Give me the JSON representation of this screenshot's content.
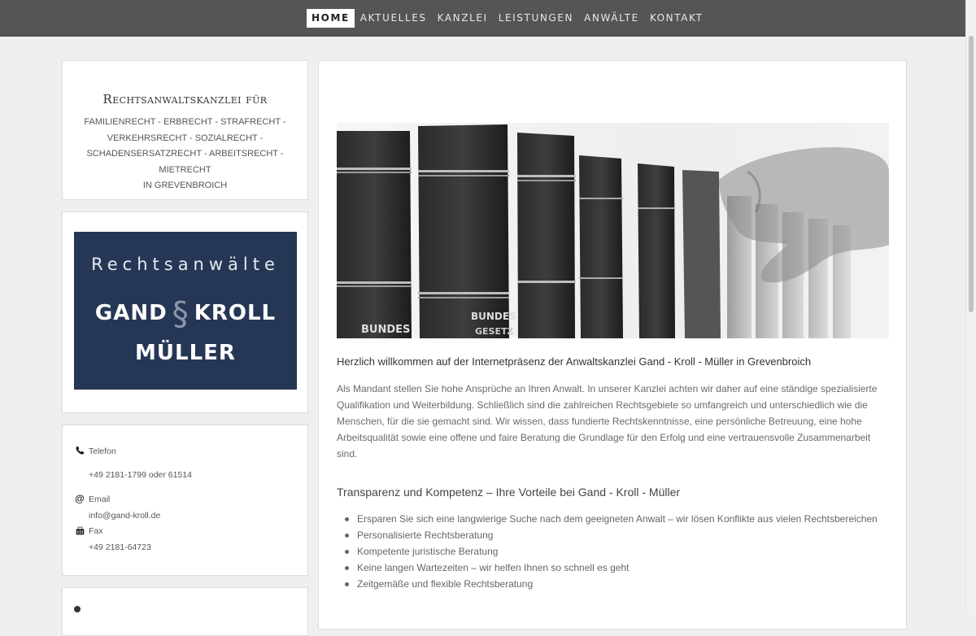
{
  "nav": {
    "items": [
      {
        "label": "HOME",
        "active": true
      },
      {
        "label": "AKTUELLES",
        "active": false
      },
      {
        "label": "KANZLEI",
        "active": false
      },
      {
        "label": "LEISTUNGEN",
        "active": false
      },
      {
        "label": "ANWÄLTE",
        "active": false
      },
      {
        "label": "KONTAKT",
        "active": false
      }
    ]
  },
  "sidebar": {
    "intro": {
      "heading": "Rechtsanwaltskanzlei für",
      "lines": [
        "FAMILIENRECHT - ERBRECHT - STRAFRECHT -",
        "VERKEHRSRECHT - SOZIALRECHT -",
        "SCHADENSERSATZRECHT - ARBEITSRECHT - MIETRECHT",
        "IN GREVENBROICH"
      ]
    },
    "logo": {
      "line1": "Rechtsanwälte",
      "name_left": "GAND",
      "symbol": "§",
      "name_right": "KROLL",
      "line3": "MÜLLER",
      "background": "#263756"
    },
    "contact": {
      "phone_label": "Telefon",
      "phone_value": "+49 2181-1799 oder 61514",
      "email_label": "Email",
      "email_value": "info@gand-kroll.de",
      "fax_label": "Fax",
      "fax_value": "+49 2181-64723"
    }
  },
  "main": {
    "hero_book_labels": [
      "BUNDES",
      "BUNDES",
      "GESETZ"
    ],
    "heading": "Herzlich willkommen auf der Internetpräsenz der Anwaltskanzlei Gand - Kroll - Müller in Grevenbroich",
    "paragraph": "Als Mandant stellen Sie hohe Ansprüche an Ihren Anwalt. In unserer Kanzlei achten wir daher auf eine ständige spezialisierte Qualifikation und Weiterbildung. Schließlich sind die zahlreichen Rechtsgebiete so umfangreich und unterschiedlich wie die Menschen, für die sie gemacht sind. Wir wissen, dass fundierte Rechtskenntnisse, eine persönliche Betreuung, eine hohe Arbeitsqualität sowie eine offene und faire Beratung die Grundlage für den Erfolg und eine vertrauensvolle Zusammenarbeit sind.",
    "subheading": "Transparenz und Kompetenz – Ihre Vorteile bei Gand - Kroll - Müller",
    "benefits": [
      "Ersparen Sie sich eine langwierige Suche nach dem geeigneten Anwalt – wir lösen Konflikte aus vielen Rechtsbereichen",
      "Personalisierte Rechtsberatung",
      "Kompetente juristische Beratung",
      "Keine langen Wartezeiten – wir helfen Ihnen so schnell es geht",
      "Zeitgemäße und flexible Rechtsberatung"
    ]
  }
}
